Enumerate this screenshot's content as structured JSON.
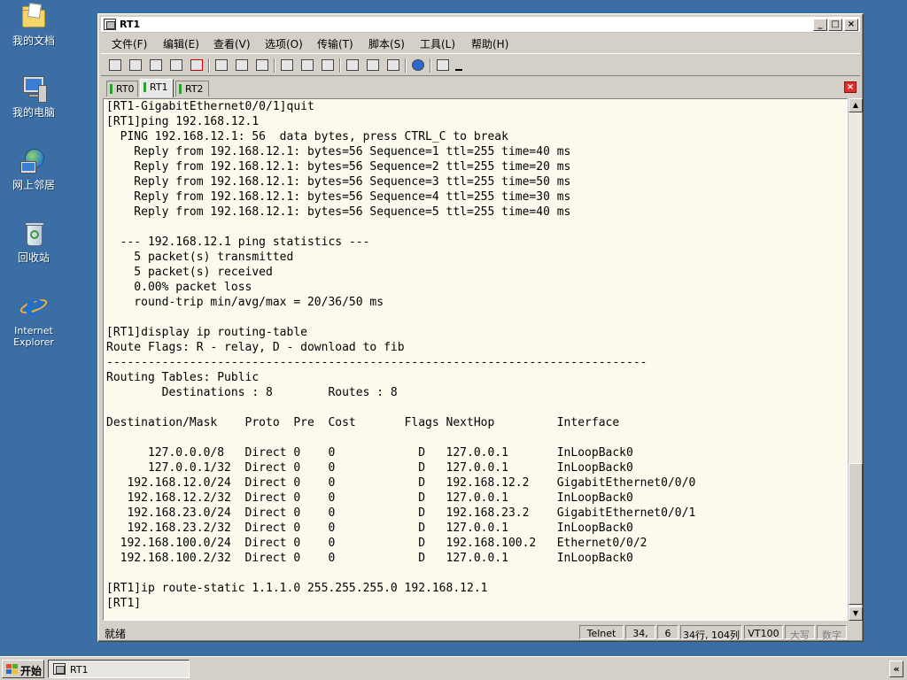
{
  "desktop": {
    "icons": [
      {
        "label": "我的文档"
      },
      {
        "label": "我的电脑"
      },
      {
        "label": "网上邻居"
      },
      {
        "label": "回收站"
      },
      {
        "label": "Internet Explorer"
      }
    ]
  },
  "window": {
    "title": "RT1",
    "controls": {
      "minimize": "_",
      "maximize": "□",
      "close": "×"
    }
  },
  "menu": [
    "文件(F)",
    "编辑(E)",
    "查看(V)",
    "选项(O)",
    "传输(T)",
    "脚本(S)",
    "工具(L)",
    "帮助(H)"
  ],
  "tabs": [
    {
      "label": "RT0",
      "active": false
    },
    {
      "label": "RT1",
      "active": true
    },
    {
      "label": "RT2",
      "active": false
    }
  ],
  "tab_close": "×",
  "terminal": {
    "lines": [
      "[RT1-GigabitEthernet0/0/1]quit",
      "[RT1]ping 192.168.12.1",
      "  PING 192.168.12.1: 56  data bytes, press CTRL_C to break",
      "    Reply from 192.168.12.1: bytes=56 Sequence=1 ttl=255 time=40 ms",
      "    Reply from 192.168.12.1: bytes=56 Sequence=2 ttl=255 time=20 ms",
      "    Reply from 192.168.12.1: bytes=56 Sequence=3 ttl=255 time=50 ms",
      "    Reply from 192.168.12.1: bytes=56 Sequence=4 ttl=255 time=30 ms",
      "    Reply from 192.168.12.1: bytes=56 Sequence=5 ttl=255 time=40 ms",
      "",
      "  --- 192.168.12.1 ping statistics ---",
      "    5 packet(s) transmitted",
      "    5 packet(s) received",
      "    0.00% packet loss",
      "    round-trip min/avg/max = 20/36/50 ms",
      "",
      "[RT1]display ip routing-table",
      "Route Flags: R - relay, D - download to fib",
      "------------------------------------------------------------------------------",
      "Routing Tables: Public",
      "        Destinations : 8        Routes : 8",
      "",
      "Destination/Mask    Proto  Pre  Cost       Flags NextHop         Interface",
      "",
      "      127.0.0.0/8   Direct 0    0            D   127.0.0.1       InLoopBack0",
      "      127.0.0.1/32  Direct 0    0            D   127.0.0.1       InLoopBack0",
      "   192.168.12.0/24  Direct 0    0            D   192.168.12.2    GigabitEthernet0/0/0",
      "   192.168.12.2/32  Direct 0    0            D   127.0.0.1       InLoopBack0",
      "   192.168.23.0/24  Direct 0    0            D   192.168.23.2    GigabitEthernet0/0/1",
      "   192.168.23.2/32  Direct 0    0            D   127.0.0.1       InLoopBack0",
      "  192.168.100.0/24  Direct 0    0            D   192.168.100.2   Ethernet0/0/2",
      "  192.168.100.2/32  Direct 0    0            D   127.0.0.1       InLoopBack0",
      "",
      "[RT1]ip route-static 1.1.1.0 255.255.255.0 192.168.12.1",
      "[RT1]"
    ]
  },
  "scrollbar": {
    "up": "▲",
    "down": "▼"
  },
  "status": {
    "text": "就绪",
    "protocol": "Telnet",
    "row": "34,",
    "col": "6",
    "size": "34行, 104列",
    "terminal_type": "VT100",
    "caps": "大写",
    "num": "数字"
  },
  "taskbar": {
    "start": "开始",
    "task": "RT1",
    "tray_arrow": "«"
  },
  "colors": {
    "desktop": "#3a6ea5",
    "terminal_bg": "#fbfaed",
    "tab_marker": "#2ca02c",
    "tab_close": "#e03030"
  }
}
